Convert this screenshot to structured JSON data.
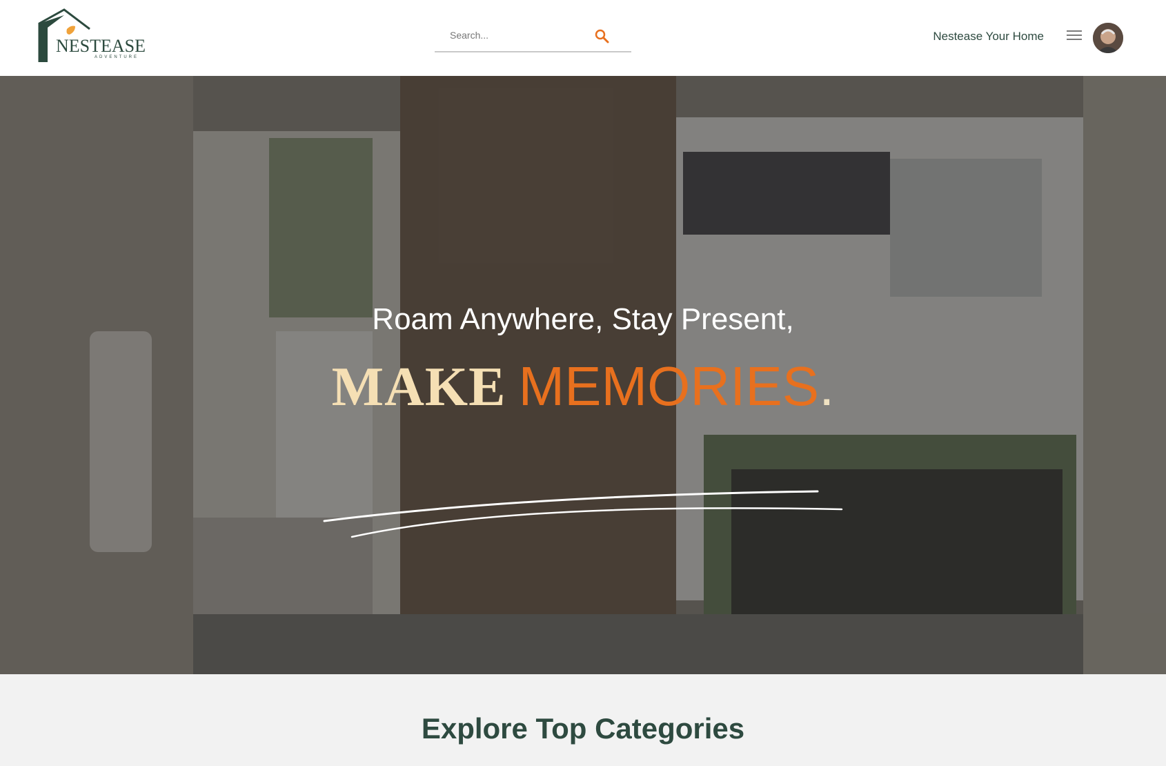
{
  "header": {
    "logo": {
      "name": "NESTEASE",
      "sub": "ADVENTURE"
    },
    "search": {
      "placeholder": "Search..."
    },
    "brand_link": "Nestease Your Home",
    "menu_icon": "hamburger-menu-icon",
    "avatar_icon": "user-avatar"
  },
  "hero": {
    "tagline": "Roam Anywhere, Stay Present,",
    "headline_part1": "MAKE",
    "headline_part2": "MEMORIES",
    "headline_dot": "."
  },
  "section": {
    "title": "Explore Top Categories"
  },
  "colors": {
    "accent": "#e8701e",
    "brand_green": "#2e4a40",
    "cream": "#f5dfb4"
  }
}
